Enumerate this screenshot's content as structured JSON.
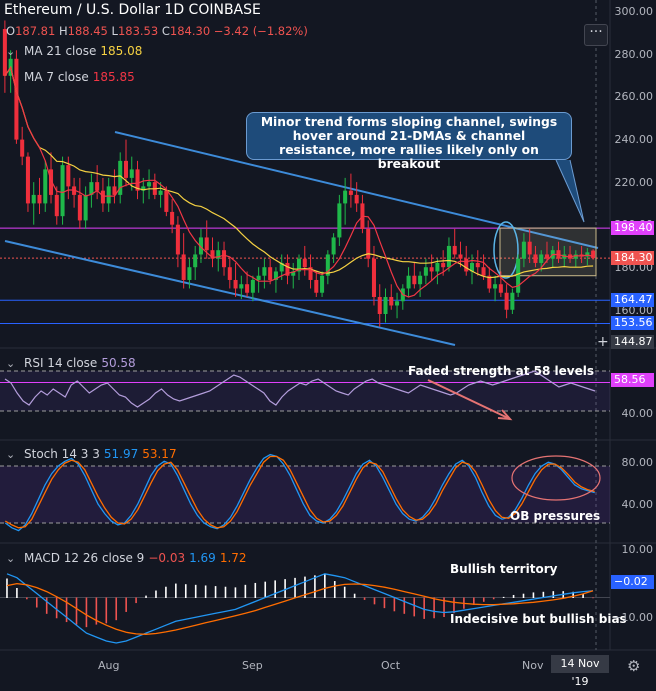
{
  "header": {
    "title": "Ethereum / U.S. Dollar  1D  COINBASE",
    "ohlc": [
      {
        "k": "O",
        "v": "187.81"
      },
      {
        "k": "H",
        "v": "188.45"
      },
      {
        "k": "L",
        "v": "183.53"
      },
      {
        "k": "C",
        "v": "184.30"
      },
      {
        "k": "",
        "v": "−3.42 (−1.82%)"
      }
    ],
    "more_label": "···"
  },
  "legends": {
    "ma21_label": "MA 21 close",
    "ma21_value": "185.08",
    "ma7_label": "MA 7 close",
    "ma7_value": "185.85",
    "rsi_label": "RSI 14 close",
    "rsi_value": "50.58",
    "stoch_label": "Stoch 14 3 3",
    "stoch_k": "51.97",
    "stoch_d": "53.17",
    "macd_label": "MACD 12 26 close 9",
    "macd_hist": "−0.03",
    "macd_line": "1.69",
    "macd_signal": "1.72"
  },
  "annotations": {
    "main": "Minor trend forms sloping channel, swings hover around 21-DMAs & channel resistance, more rallies likely only on breakout",
    "rsi": "Faded strength at 58 levels",
    "stoch": "OB pressures",
    "macd1": "Bullish territory",
    "macd2": "Indecisive but bullish bias"
  },
  "colors": {
    "background": "#131722",
    "up": "#26a69a",
    "up_fill": "#1fb84a",
    "down": "#ef2f3c",
    "ma21": "#f5d142",
    "ma7": "#f23645",
    "channel": "#3d8bd9",
    "hline_magenta": "#e040fb",
    "hline_blue": "#2962ff",
    "rsi": "#b39ddb",
    "stoch_k": "#2196f3",
    "stoch_d": "#ff6d00",
    "macd": "#2196f3",
    "macd_signal": "#ff6d00"
  },
  "icons": {
    "eye": "eye-icon",
    "settings": "gear-icon",
    "crosshair": "plus-icon"
  },
  "price_axis": {
    "labels": [
      "300.00",
      "280.00",
      "260.00",
      "240.00",
      "220.00",
      "200.00",
      "180.00",
      "160.00"
    ],
    "badges": [
      {
        "text": "198.40",
        "value": 198.4,
        "bg": "#e040fb"
      },
      {
        "text": "184.30",
        "value": 184.3,
        "bg": "#ef5350"
      },
      {
        "text": "164.47",
        "value": 164.47,
        "bg": "#2962ff"
      },
      {
        "text": "153.56",
        "value": 153.56,
        "bg": "#2962ff"
      },
      {
        "text": "144.87",
        "value": 144.87,
        "bg": "#363a45"
      }
    ]
  },
  "rsi_axis": {
    "labels": [
      "40.00"
    ],
    "badge": "58.56"
  },
  "stoch_axis": {
    "labels": [
      "80.00",
      "40.00"
    ]
  },
  "macd_axis": {
    "labels": [
      "10.00",
      "−10.00"
    ],
    "badge": "−0.02"
  },
  "time_axis": {
    "labels": [
      "Aug",
      "Sep",
      "Oct",
      "Nov"
    ],
    "current_date": "14 Nov '19"
  },
  "chart_data": {
    "type": "candlestick",
    "title": "Ethereum / U.S. Dollar 1D COINBASE",
    "ylim": [
      145,
      302
    ],
    "horizontal_levels": [
      198.4,
      164.47,
      153.56
    ],
    "candles": [
      [
        292,
        296,
        262,
        270
      ],
      [
        270,
        282,
        262,
        278
      ],
      [
        278,
        282,
        238,
        240
      ],
      [
        240,
        246,
        228,
        232
      ],
      [
        232,
        234,
        206,
        210
      ],
      [
        210,
        220,
        200,
        214
      ],
      [
        214,
        222,
        205,
        210
      ],
      [
        210,
        230,
        206,
        226
      ],
      [
        226,
        234,
        210,
        214
      ],
      [
        214,
        218,
        200,
        204
      ],
      [
        204,
        232,
        200,
        228
      ],
      [
        228,
        232,
        212,
        218
      ],
      [
        218,
        222,
        208,
        214
      ],
      [
        214,
        222,
        198,
        202
      ],
      [
        202,
        218,
        198,
        214
      ],
      [
        214,
        224,
        208,
        220
      ],
      [
        220,
        228,
        212,
        216
      ],
      [
        216,
        222,
        206,
        210
      ],
      [
        210,
        222,
        206,
        218
      ],
      [
        218,
        226,
        210,
        214
      ],
      [
        214,
        234,
        210,
        230
      ],
      [
        230,
        240,
        218,
        222
      ],
      [
        222,
        232,
        216,
        226
      ],
      [
        226,
        230,
        212,
        216
      ],
      [
        216,
        222,
        210,
        218
      ],
      [
        218,
        226,
        212,
        220
      ],
      [
        220,
        224,
        212,
        214
      ],
      [
        214,
        220,
        208,
        216
      ],
      [
        216,
        218,
        204,
        206
      ],
      [
        206,
        212,
        196,
        200
      ],
      [
        200,
        204,
        180,
        186
      ],
      [
        186,
        196,
        170,
        174
      ],
      [
        174,
        184,
        170,
        180
      ],
      [
        180,
        190,
        174,
        186
      ],
      [
        186,
        198,
        182,
        194
      ],
      [
        194,
        202,
        184,
        188
      ],
      [
        188,
        194,
        180,
        184
      ],
      [
        184,
        192,
        178,
        188
      ],
      [
        188,
        192,
        176,
        180
      ],
      [
        180,
        184,
        170,
        174
      ],
      [
        174,
        182,
        166,
        170
      ],
      [
        170,
        176,
        165,
        172
      ],
      [
        172,
        178,
        166,
        168
      ],
      [
        168,
        176,
        164,
        174
      ],
      [
        174,
        180,
        168,
        176
      ],
      [
        176,
        184,
        170,
        180
      ],
      [
        180,
        184,
        172,
        174
      ],
      [
        174,
        180,
        168,
        178
      ],
      [
        178,
        186,
        174,
        182
      ],
      [
        182,
        186,
        172,
        176
      ],
      [
        176,
        182,
        170,
        178
      ],
      [
        178,
        186,
        174,
        184
      ],
      [
        184,
        190,
        176,
        180
      ],
      [
        180,
        186,
        170,
        174
      ],
      [
        174,
        178,
        166,
        168
      ],
      [
        168,
        178,
        166,
        176
      ],
      [
        176,
        188,
        172,
        186
      ],
      [
        186,
        196,
        182,
        194
      ],
      [
        194,
        214,
        190,
        210
      ],
      [
        210,
        222,
        200,
        216
      ],
      [
        216,
        224,
        208,
        214
      ],
      [
        214,
        220,
        206,
        210
      ],
      [
        210,
        214,
        196,
        198
      ],
      [
        198,
        202,
        180,
        184
      ],
      [
        184,
        190,
        162,
        166
      ],
      [
        166,
        172,
        152,
        158
      ],
      [
        158,
        170,
        154,
        166
      ],
      [
        166,
        172,
        160,
        162
      ],
      [
        162,
        168,
        156,
        164
      ],
      [
        164,
        172,
        160,
        170
      ],
      [
        170,
        180,
        166,
        176
      ],
      [
        176,
        182,
        170,
        172
      ],
      [
        172,
        178,
        166,
        176
      ],
      [
        176,
        184,
        172,
        180
      ],
      [
        180,
        186,
        174,
        178
      ],
      [
        178,
        184,
        172,
        182
      ],
      [
        182,
        188,
        176,
        180
      ],
      [
        180,
        194,
        178,
        190
      ],
      [
        190,
        198,
        184,
        186
      ],
      [
        186,
        192,
        180,
        184
      ],
      [
        184,
        190,
        176,
        178
      ],
      [
        178,
        186,
        172,
        182
      ],
      [
        182,
        188,
        176,
        180
      ],
      [
        180,
        186,
        174,
        176
      ],
      [
        176,
        180,
        168,
        170
      ],
      [
        170,
        176,
        164,
        172
      ],
      [
        172,
        178,
        166,
        168
      ],
      [
        168,
        172,
        156,
        160
      ],
      [
        160,
        170,
        158,
        168
      ],
      [
        168,
        186,
        166,
        184
      ],
      [
        184,
        196,
        180,
        192
      ],
      [
        192,
        198,
        182,
        186
      ],
      [
        186,
        190,
        180,
        182
      ],
      [
        182,
        188,
        178,
        186
      ],
      [
        186,
        192,
        182,
        184
      ],
      [
        184,
        190,
        180,
        188
      ],
      [
        188,
        192,
        182,
        184
      ],
      [
        184,
        190,
        180,
        186
      ],
      [
        186,
        190,
        182,
        184
      ],
      [
        184,
        188,
        180,
        186
      ],
      [
        186,
        190,
        182,
        185
      ],
      [
        185,
        189,
        181,
        187
      ],
      [
        187.81,
        188.45,
        183.53,
        184.3
      ]
    ],
    "rsi": [
      62,
      58,
      48,
      40,
      36,
      44,
      50,
      46,
      52,
      48,
      44,
      56,
      60,
      54,
      48,
      52,
      56,
      58,
      52,
      46,
      44,
      38,
      34,
      38,
      42,
      48,
      52,
      46,
      42,
      40,
      42,
      44,
      46,
      48,
      50,
      54,
      58,
      62,
      66,
      64,
      60,
      56,
      52,
      48,
      40,
      36,
      44,
      50,
      54,
      58,
      56,
      60,
      62,
      58,
      54,
      50,
      48,
      46,
      52,
      56,
      60,
      62,
      58,
      56,
      54,
      52,
      50,
      48,
      52,
      56,
      54,
      52,
      50,
      48,
      46,
      48,
      52,
      56,
      58,
      60,
      58,
      56,
      58,
      60,
      62,
      64,
      66,
      68,
      70,
      66,
      62,
      58,
      54,
      56,
      58,
      56,
      54,
      52,
      50
    ],
    "stoch_k": [
      20,
      15,
      12,
      18,
      30,
      45,
      60,
      72,
      80,
      85,
      88,
      82,
      70,
      55,
      40,
      30,
      22,
      18,
      20,
      28,
      40,
      55,
      70,
      80,
      85,
      82,
      70,
      55,
      40,
      28,
      20,
      16,
      14,
      18,
      26,
      38,
      52,
      66,
      78,
      88,
      92,
      90,
      82,
      70,
      55,
      40,
      28,
      22,
      20,
      24,
      32,
      44,
      58,
      72,
      82,
      86,
      80,
      68,
      54,
      40,
      30,
      24,
      22,
      26,
      34,
      46,
      60,
      72,
      82,
      86,
      80,
      68,
      52,
      38,
      28,
      24,
      26,
      34,
      46,
      60,
      72,
      80,
      84,
      82,
      76,
      68,
      60,
      56,
      54,
      52
    ],
    "stoch_d": [
      22,
      18,
      15,
      16,
      24,
      38,
      52,
      66,
      76,
      83,
      86,
      84,
      76,
      62,
      48,
      36,
      26,
      20,
      19,
      24,
      34,
      48,
      62,
      75,
      82,
      84,
      76,
      62,
      48,
      34,
      24,
      18,
      15,
      16,
      22,
      32,
      46,
      60,
      72,
      84,
      90,
      90,
      86,
      76,
      62,
      48,
      34,
      25,
      21,
      22,
      28,
      38,
      52,
      66,
      78,
      84,
      82,
      74,
      60,
      46,
      34,
      27,
      23,
      24,
      30,
      40,
      54,
      66,
      78,
      84,
      82,
      74,
      60,
      45,
      33,
      26,
      25,
      30,
      40,
      53,
      66,
      76,
      82,
      82,
      78,
      71,
      63,
      58,
      55,
      53.17
    ],
    "macd": [
      6,
      5,
      3,
      1,
      -1,
      -3,
      -5,
      -7,
      -9,
      -10,
      -11,
      -11.5,
      -11,
      -10,
      -9,
      -8,
      -7,
      -6,
      -5.5,
      -5,
      -4.5,
      -4,
      -3.5,
      -3,
      -2,
      -1,
      0,
      1,
      2,
      3,
      4,
      5,
      6,
      5.5,
      5,
      4,
      3,
      2,
      1,
      0,
      -1,
      -2,
      -3,
      -3.5,
      -3.8,
      -3.6,
      -3.2,
      -2.8,
      -2.4,
      -2,
      -1.6,
      -1.2,
      -0.8,
      -0.4,
      0,
      0.4,
      0.8,
      1.2,
      1.5,
      1.69
    ],
    "macd_signal": [
      3,
      3.5,
      3.2,
      2.5,
      1.5,
      0.2,
      -1.2,
      -2.8,
      -4.4,
      -5.8,
      -7,
      -8,
      -8.8,
      -9.2,
      -9.3,
      -9.1,
      -8.7,
      -8.2,
      -7.6,
      -7,
      -6.4,
      -5.8,
      -5.2,
      -4.6,
      -4,
      -3.3,
      -2.5,
      -1.7,
      -0.9,
      -0.1,
      0.7,
      1.5,
      2.3,
      2.9,
      3.3,
      3.4,
      3.3,
      3,
      2.6,
      2.1,
      1.5,
      0.9,
      0.3,
      -0.3,
      -0.8,
      -1.2,
      -1.5,
      -1.7,
      -1.8,
      -1.8,
      -1.7,
      -1.6,
      -1.4,
      -1.2,
      -0.9,
      -0.6,
      -0.2,
      0.3,
      0.9,
      1.72
    ]
  }
}
